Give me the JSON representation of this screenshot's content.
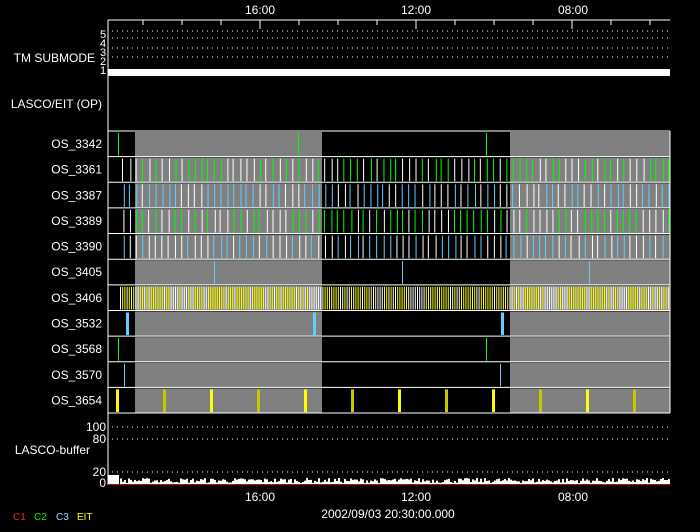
{
  "time_axis": {
    "labels": [
      "16:00",
      "12:00",
      "08:00"
    ]
  },
  "tm_submode": {
    "label": "TM SUBMODE",
    "levels": [
      "5",
      "4",
      "3",
      "2",
      "1"
    ]
  },
  "lasco_eit": {
    "label": "LASCO/EIT (OP)"
  },
  "rows": [
    {
      "label": "OS_3342",
      "color": "#00ff00"
    },
    {
      "label": "OS_3361",
      "color": "#00ff00"
    },
    {
      "label": "OS_3387",
      "color": "#66ccff"
    },
    {
      "label": "OS_3389",
      "color": "#00ff00"
    },
    {
      "label": "OS_3390",
      "color": "#66ccff"
    },
    {
      "label": "OS_3405",
      "color": "#66ccff"
    },
    {
      "label": "OS_3406",
      "color": "#ffff00"
    },
    {
      "label": "OS_3532",
      "color": "#66ccff"
    },
    {
      "label": "OS_3568",
      "color": "#00ff00"
    },
    {
      "label": "OS_3570",
      "color": "#66ccff"
    },
    {
      "label": "OS_3654",
      "color": "#ffff00"
    }
  ],
  "buffer": {
    "label": "LASCO-buffer",
    "ticks": [
      "100",
      "80",
      "20",
      "0"
    ]
  },
  "legend": [
    {
      "label": "C1",
      "color": "#ff2020"
    },
    {
      "label": "C2",
      "color": "#00ff00"
    },
    {
      "label": "C3",
      "color": "#99ddff"
    },
    {
      "label": "EIT",
      "color": "#ffff00"
    }
  ],
  "timestamp": "2002/09/03 20:30:00.000"
}
